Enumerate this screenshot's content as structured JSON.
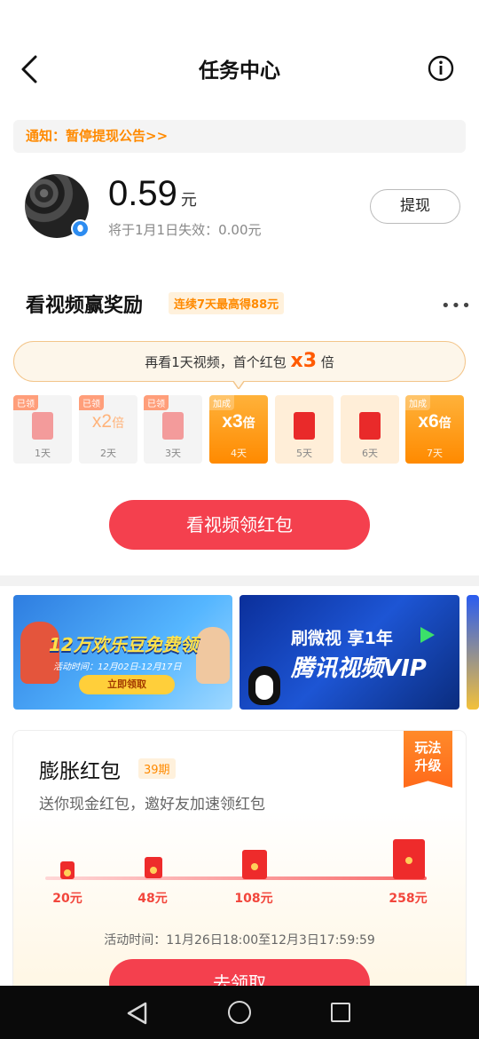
{
  "header": {
    "title": "任务中心"
  },
  "notice": {
    "text": "通知：暂停提现公告>>"
  },
  "balance": {
    "amount": "0.59",
    "unit": "元",
    "expire": "将于1月1日失效：0.00元",
    "withdraw_label": "提现"
  },
  "video_reward": {
    "title": "看视频赢奖励",
    "tag": "连续7天最高得88元",
    "more": "•••",
    "bubble_prefix": "再看1天视频，首个红包",
    "bubble_mult": "x3",
    "bubble_suffix": "倍",
    "days": [
      {
        "tag": "已领",
        "label": "1天",
        "state": "collected"
      },
      {
        "tag": "已领",
        "mult": "x2",
        "mult_unit": "倍",
        "label": "2天",
        "state": "collected"
      },
      {
        "tag": "已领",
        "label": "3天",
        "state": "collected"
      },
      {
        "tag": "加成",
        "mult": "x3",
        "mult_unit": "倍",
        "label": "4天",
        "state": "bonus"
      },
      {
        "label": "5天",
        "state": "pending"
      },
      {
        "label": "6天",
        "state": "pending"
      },
      {
        "tag": "加成",
        "mult": "x6",
        "mult_unit": "倍",
        "label": "7天",
        "state": "bonus"
      }
    ],
    "button_label": "看视频领红包"
  },
  "banners": {
    "b1_title_a": "12万欢乐豆",
    "b1_title_b": "免费领",
    "b1_time": "活动时间：12月02日-12月17日",
    "b1_button": "立即领取",
    "b2_line1": "刷微视 享1年",
    "b2_line2": "腾讯视频VIP"
  },
  "inflation": {
    "ribbon_line1": "玩法",
    "ribbon_line2": "升级",
    "title": "膨胀红包",
    "issue": "39期",
    "subtitle": "送你现金红包，邀好友加速领红包",
    "tiers": [
      {
        "label": "20元"
      },
      {
        "label": "48元"
      },
      {
        "label": "108元"
      },
      {
        "label": "258元"
      }
    ],
    "time": "活动时间：11月26日18:00至12月3日17:59:59",
    "button_label": "去领取"
  },
  "colors": {
    "accent_red": "#f4404e",
    "accent_orange": "#ff8a00"
  }
}
